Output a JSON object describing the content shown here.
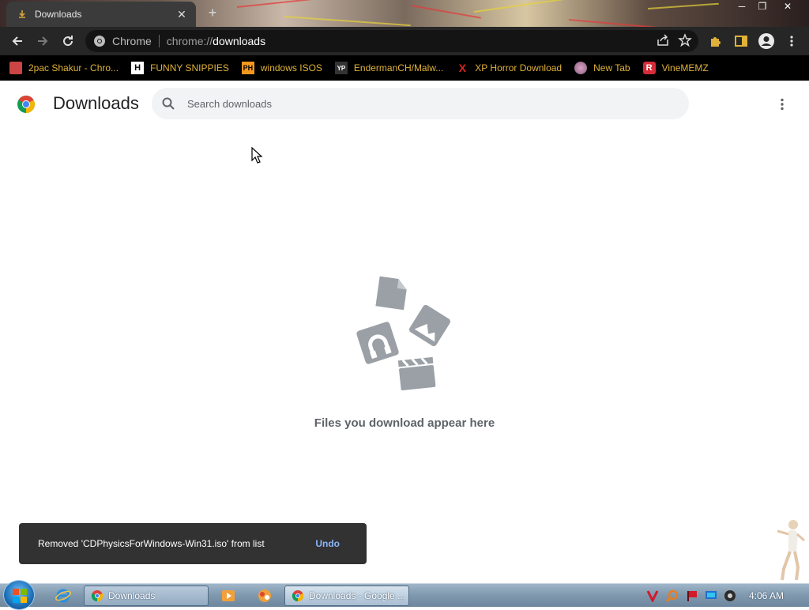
{
  "window": {
    "tab_title": "Downloads",
    "new_tab_symbol": "+",
    "close_tab_symbol": "✕"
  },
  "toolbar": {
    "site_chip": "Chrome",
    "url_scheme": "chrome://",
    "url_host": "downloads"
  },
  "bookmarks": [
    {
      "label": "2pac Shakur - Chro...",
      "icon": "tupac-favicon-icon",
      "icon_text": ""
    },
    {
      "label": "FUNNY SNIPPIES",
      "icon": "h-favicon-icon",
      "icon_text": "H"
    },
    {
      "label": "windows ISOS",
      "icon": "ph-favicon-icon",
      "icon_text": "PH"
    },
    {
      "label": "EndermanCH/Malw...",
      "icon": "yp-favicon-icon",
      "icon_text": "YP"
    },
    {
      "label": "XP Horror Download",
      "icon": "x-favicon-icon",
      "icon_text": "X"
    },
    {
      "label": "New Tab",
      "icon": "globe-favicon-icon",
      "icon_text": ""
    },
    {
      "label": "VineMEMZ",
      "icon": "r-favicon-icon",
      "icon_text": "R"
    }
  ],
  "page": {
    "title": "Downloads",
    "search_placeholder": "Search downloads",
    "empty_message": "Files you download appear here"
  },
  "toast": {
    "message": "Removed 'CDPhysicsForWindows-Win31.iso' from list",
    "action": "Undo"
  },
  "taskbar": {
    "buttons": [
      {
        "label": "Downloads",
        "icon": "chrome-icon"
      },
      {
        "label": "Downloads - Google ...",
        "icon": "chrome-icon"
      }
    ],
    "clock": "4:06 AM"
  },
  "colors": {
    "toolbar_bg": "#262626",
    "bookmark_text": "#e0b23a",
    "toast_bg": "#323232",
    "toast_action": "#8ab4f8",
    "empty_icon": "#9aa0a6"
  }
}
